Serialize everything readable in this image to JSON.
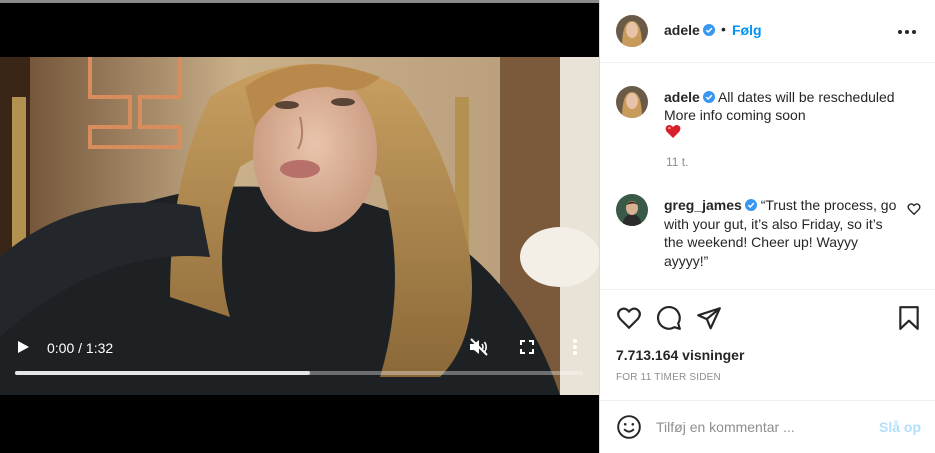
{
  "video": {
    "time_label": "0:00 / 1:32",
    "progress_fraction": 0.52
  },
  "header": {
    "username": "adele",
    "separator": "•",
    "follow_label": "Følg"
  },
  "caption": {
    "username": "adele",
    "line1": "All dates will be rescheduled",
    "line2": "More info coming soon",
    "emoji": "red-heart",
    "time": "11 t."
  },
  "comment": {
    "username": "greg_james",
    "text": "“Trust the process, go with your gut, it’s also Friday, so it’s the weekend! Cheer up! Wayyy ayyyy!”"
  },
  "stats": {
    "views": "7.713.164 visninger",
    "ago": "FOR 11 TIMER SIDEN"
  },
  "add_comment": {
    "placeholder": "Tilføj en kommentar ...",
    "post_label": "Slå op"
  },
  "icons": {
    "verified": "verified-badge-icon",
    "like": "heart-outline-icon",
    "comment": "comment-bubble-icon",
    "share": "paper-plane-icon",
    "save": "bookmark-icon",
    "emoji": "smiley-icon",
    "options": "more-horizontal-icon"
  },
  "colors": {
    "accent": "#0095f6",
    "verified": "#3897f0",
    "post_disabled": "#b2dffc",
    "muted_text": "#8e8e8e"
  }
}
